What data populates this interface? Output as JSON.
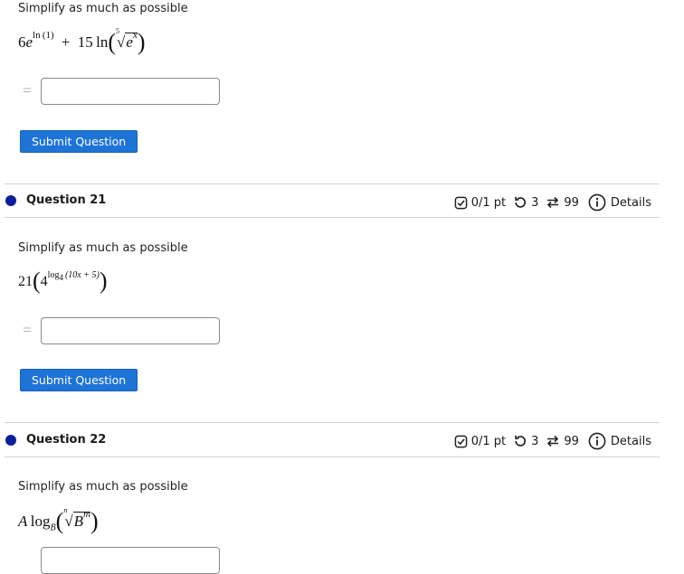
{
  "prompt": "Simplify as much as possible",
  "equals_sign": "=",
  "submit_label": "Submit Question",
  "q20": {
    "coef": "6",
    "base": "e",
    "exp_func": "ln",
    "exp_arg": "(1)",
    "plus": "+",
    "coef2": "15",
    "ln": "ln",
    "root_index": "5",
    "root_base": "e",
    "root_exp": "x"
  },
  "questions": [
    {
      "title": "Question 21",
      "score": "0/1 pt",
      "retries": "3",
      "attempts": "99",
      "details_label": "Details",
      "expr": {
        "coef": "21",
        "base": "4",
        "log": "log",
        "log_base": "4",
        "log_arg": "(10x + 5)"
      }
    },
    {
      "title": "Question 22",
      "score": "0/1 pt",
      "retries": "3",
      "attempts": "99",
      "details_label": "Details",
      "expr": {
        "A": "A",
        "log": "log",
        "log_base": "B",
        "root_index": "n",
        "root_base": "B",
        "root_exp": "m"
      }
    }
  ],
  "colors": {
    "button": "#1e73d6",
    "bullet": "#0a1f9a",
    "divider": "#cfcfcf"
  },
  "icons": [
    "checkbox-score-icon",
    "retry-icon",
    "attempts-icon",
    "info-icon"
  ]
}
